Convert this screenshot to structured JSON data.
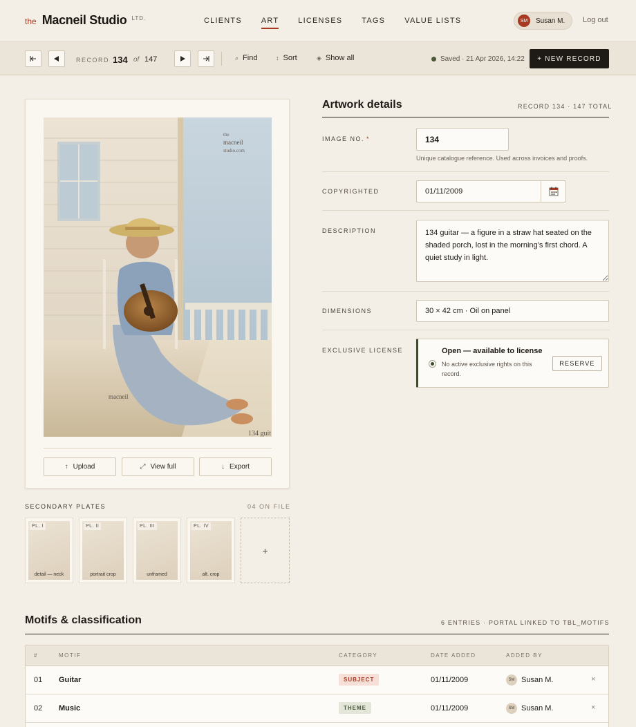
{
  "header": {
    "brand_prefix": "the",
    "brand_name": "Macneil Studio",
    "brand_suffix": "LTD.",
    "nav": [
      {
        "label": "CLIENTS",
        "active": false
      },
      {
        "label": "ART",
        "active": true
      },
      {
        "label": "LICENSES",
        "active": false
      },
      {
        "label": "TAGS",
        "active": false
      },
      {
        "label": "VALUE LISTS",
        "active": false
      }
    ],
    "user": {
      "initials": "SM",
      "name": "Susan M."
    },
    "logout_label": "Log out"
  },
  "toolbar": {
    "record_label": "RECORD",
    "record_current": "134",
    "record_of": "of",
    "record_total": "147",
    "find_label": "Find",
    "sort_label": "Sort",
    "show_all_label": "Show all",
    "saved_status": "Saved · 21 Apr 2026, 14:22",
    "new_record_label": "+ NEW RECORD"
  },
  "image_card": {
    "artwork_icon": "artwork-image",
    "watermark_the": "the",
    "watermark_name": "macneil",
    "watermark_site": "studio.com",
    "signature": "macneil",
    "caption": "134 guit",
    "upload_label": "Upload",
    "view_full_label": "View full",
    "export_label": "Export"
  },
  "secondary_plates": {
    "title": "SECONDARY PLATES",
    "count": "04 ON FILE",
    "plates": [
      {
        "tag": "PL. I",
        "caption": "detail — neck"
      },
      {
        "tag": "PL. II",
        "caption": "portrait crop"
      },
      {
        "tag": "PL. III",
        "caption": "unframed"
      },
      {
        "tag": "PL. IV",
        "caption": "alt. crop"
      }
    ],
    "add_label": "+"
  },
  "details": {
    "title": "Artwork details",
    "meta": "RECORD 134 · 147 TOTAL",
    "image_no_label": "IMAGE NO.",
    "required_mark": "*",
    "image_no_value": "134",
    "image_no_hint": "Unique catalogue reference. Used across invoices and proofs.",
    "copyrighted_label": "COPYRIGHTED",
    "copyrighted_value": "01/11/2009",
    "description_label": "DESCRIPTION",
    "description_value": "134 guitar — a figure in a straw hat seated on the shaded porch, lost in the morning’s first chord. A quiet study in light.",
    "dimensions_label": "DIMENSIONS",
    "dimensions_value": "30 × 42 cm · Oil on panel",
    "license_label": "EXCLUSIVE LICENSE",
    "license_title": "Open — available to license",
    "license_sub": "No active exclusive rights on this record.",
    "reserve_label": "RESERVE"
  },
  "motifs": {
    "title": "Motifs & classification",
    "meta": "6 ENTRIES · PORTAL LINKED TO TBL_MOTIFS",
    "columns": [
      "#",
      "MOTIF",
      "CATEGORY",
      "DATE ADDED",
      "ADDED BY"
    ],
    "rows": [
      {
        "num": "01",
        "motif": "Guitar",
        "category": "SUBJECT",
        "date": "01/11/2009",
        "by_initials": "SM",
        "by": "Susan M."
      },
      {
        "num": "02",
        "motif": "Music",
        "category": "THEME",
        "date": "01/11/2009",
        "by_initials": "SM",
        "by": "Susan M."
      }
    ],
    "delete_label": "×"
  },
  "colors": {
    "accent": "#a83a22",
    "ink": "#1e1a16",
    "paper": "#f3efe7",
    "license_green": "#3e4a30"
  }
}
